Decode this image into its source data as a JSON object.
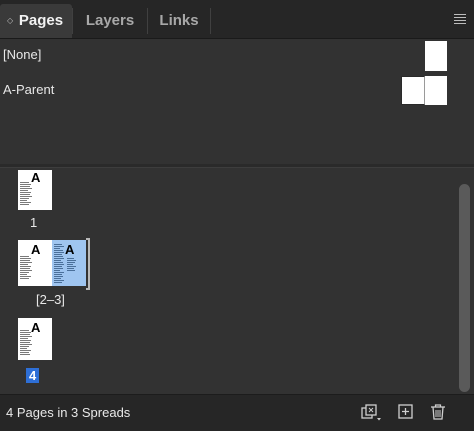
{
  "panel": {
    "tabs": [
      {
        "label": "Pages",
        "active": true
      },
      {
        "label": "Layers",
        "active": false
      },
      {
        "label": "Links",
        "active": false
      }
    ]
  },
  "masters": [
    {
      "label": "[None]",
      "pages": 1
    },
    {
      "label": "A-Parent",
      "pages": 2
    }
  ],
  "pages": [
    {
      "label": "1",
      "thumb_letter": "A",
      "selected": false
    },
    {
      "label": "[2–3]",
      "thumb_letters": [
        "A",
        "A"
      ],
      "selected_right": true
    },
    {
      "label": "4",
      "thumb_letter": "A",
      "selected": true
    }
  ],
  "footer": {
    "status": "4 Pages in 3 Spreads",
    "buttons": [
      "edit-page-size-icon",
      "new-page-icon",
      "delete-page-icon"
    ]
  },
  "colors": {
    "panel_bg": "#323232",
    "tabbar_bg": "#262626",
    "selection_blue": "#2e6fd6",
    "selected_page_fill": "#9fc5f0"
  }
}
